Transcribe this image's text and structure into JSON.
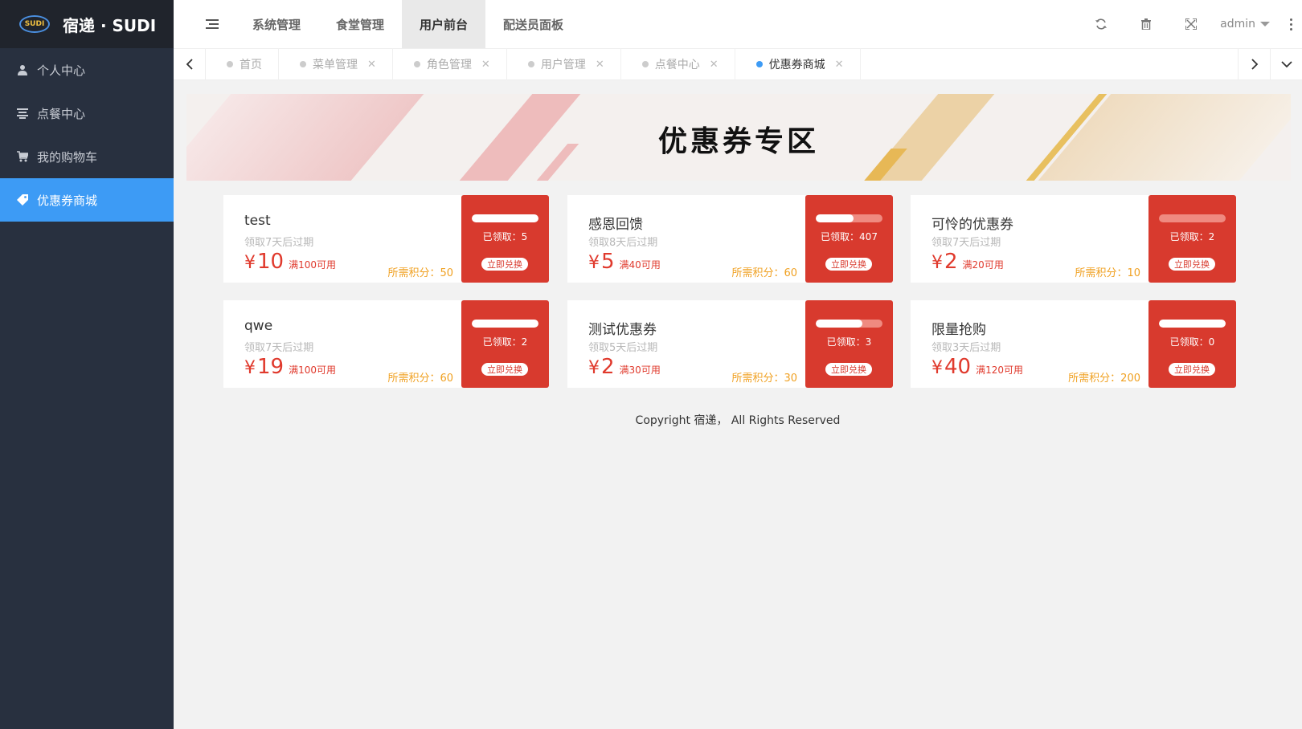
{
  "app": {
    "logo_badge": "SUDI",
    "title": "宿递 · SUDI"
  },
  "sidebar": {
    "items": [
      {
        "label": "个人中心",
        "icon": "user-icon"
      },
      {
        "label": "点餐中心",
        "icon": "order-icon"
      },
      {
        "label": "我的购物车",
        "icon": "cart-icon"
      },
      {
        "label": "优惠券商城",
        "icon": "tag-icon",
        "active": true
      }
    ]
  },
  "header": {
    "nav": [
      {
        "label": "系统管理"
      },
      {
        "label": "食堂管理"
      },
      {
        "label": "用户前台",
        "active": true
      },
      {
        "label": "配送员面板"
      }
    ],
    "user": "admin"
  },
  "tabs": [
    {
      "label": "首页",
      "closable": false
    },
    {
      "label": "菜单管理",
      "closable": true
    },
    {
      "label": "角色管理",
      "closable": true
    },
    {
      "label": "用户管理",
      "closable": true
    },
    {
      "label": "点餐中心",
      "closable": true
    },
    {
      "label": "优惠券商城",
      "closable": true,
      "active": true
    }
  ],
  "banner": {
    "title": "优惠券专区"
  },
  "coupons": [
    {
      "name": "test",
      "expire": "领取7天后过期",
      "currency": "¥",
      "amount": "10",
      "condition": "满100可用",
      "points": "所需积分：50",
      "claimed": "已领取：5",
      "progress": 1.0,
      "button": "立即兑换"
    },
    {
      "name": "感恩回馈",
      "expire": "领取8天后过期",
      "currency": "¥",
      "amount": "5",
      "condition": "满40可用",
      "points": "所需积分：60",
      "claimed": "已领取：407",
      "progress": 0.57,
      "button": "立即兑换"
    },
    {
      "name": "可怜的优惠券",
      "expire": "领取7天后过期",
      "currency": "¥",
      "amount": "2",
      "condition": "满20可用",
      "points": "所需积分：10",
      "claimed": "已领取：2",
      "progress": 0.0,
      "button": "立即兑换"
    },
    {
      "name": "qwe",
      "expire": "领取7天后过期",
      "currency": "¥",
      "amount": "19",
      "condition": "满100可用",
      "points": "所需积分：60",
      "claimed": "已领取：2",
      "progress": 1.0,
      "button": "立即兑换"
    },
    {
      "name": "测试优惠券",
      "expire": "领取5天后过期",
      "currency": "¥",
      "amount": "2",
      "condition": "满30可用",
      "points": "所需积分：30",
      "claimed": "已领取：3",
      "progress": 0.7,
      "button": "立即兑换"
    },
    {
      "name": "限量抢购",
      "expire": "领取3天后过期",
      "currency": "¥",
      "amount": "40",
      "condition": "满120可用",
      "points": "所需积分：200",
      "claimed": "已领取：0",
      "progress": 1.0,
      "button": "立即兑换"
    }
  ],
  "footer": {
    "copyright": "Copyright 宿递， All Rights Reserved"
  },
  "colors": {
    "sidebar_bg": "#28303f",
    "active_blue": "#3d9bf5",
    "coupon_red": "#d83a2e",
    "points_orange": "#f0a020"
  }
}
